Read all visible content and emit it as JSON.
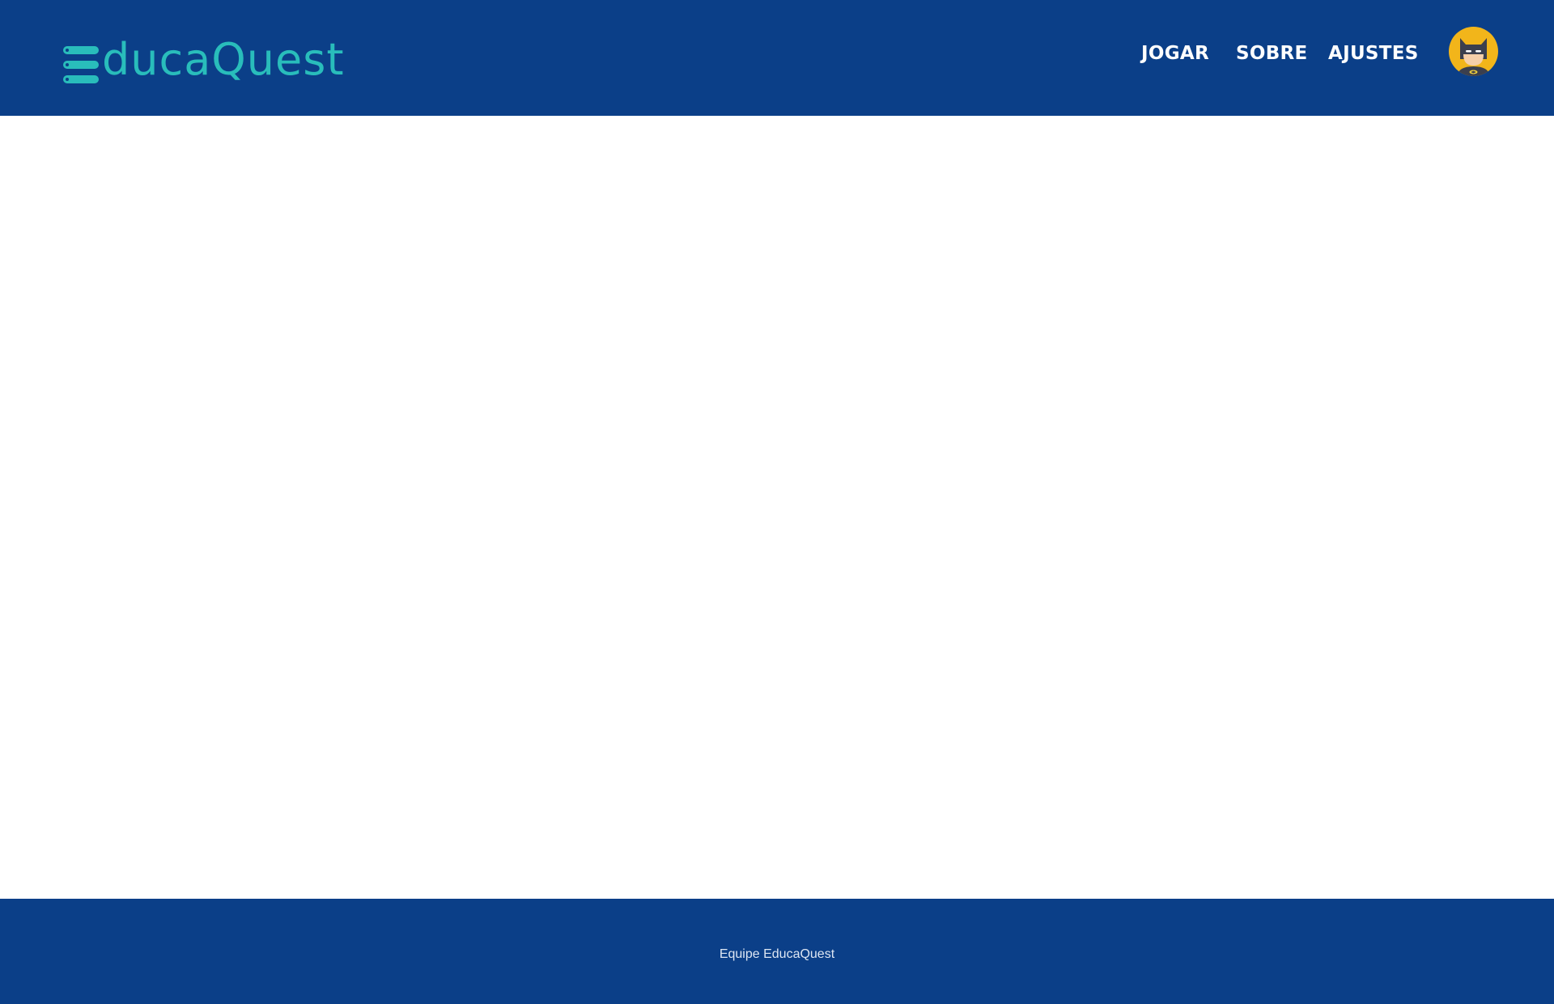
{
  "header": {
    "logo_text": "EducaQuest",
    "logo_suffix": "ducaQuest",
    "nav": [
      {
        "label": "JOGAR"
      },
      {
        "label": "SOBRE"
      },
      {
        "label": "AJUSTES"
      }
    ],
    "avatar_icon": "batman-avatar-icon"
  },
  "colors": {
    "header_bg": "#0b3f88",
    "accent": "#29bdbb",
    "avatar_bg": "#f2b51a"
  },
  "footer": {
    "text": "Equipe EducaQuest"
  }
}
